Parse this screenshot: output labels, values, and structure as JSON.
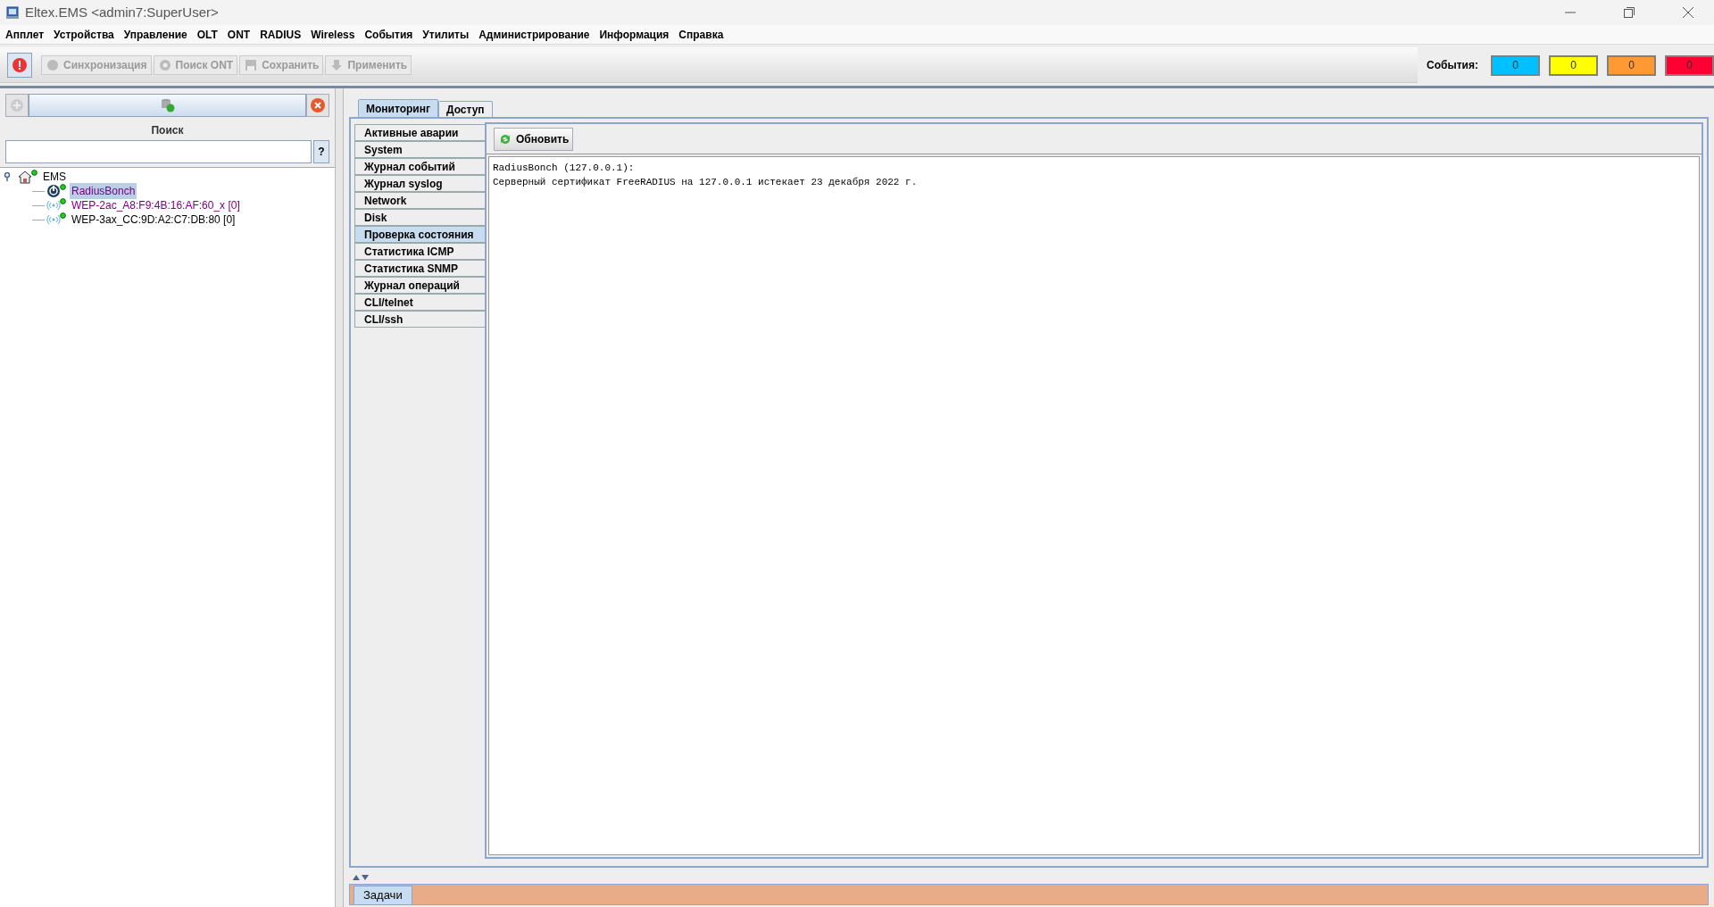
{
  "window": {
    "title": "Eltex.EMS <admin7:SuperUser>"
  },
  "menu": [
    "Апплет",
    "Устройства",
    "Управление",
    "OLT",
    "ONT",
    "RADIUS",
    "Wireless",
    "События",
    "Утилиты",
    "Администрирование",
    "Информация",
    "Справка"
  ],
  "toolbar": {
    "buttons": [
      {
        "label": "Синхронизация",
        "disabled": true
      },
      {
        "label": "Поиск ONT",
        "disabled": true
      },
      {
        "label": "Сохранить",
        "disabled": true
      },
      {
        "label": "Применить",
        "disabled": true
      }
    ]
  },
  "events": {
    "label": "События:",
    "counters": [
      {
        "value": "0",
        "color": "#00c0ff"
      },
      {
        "value": "0",
        "color": "#ffff00"
      },
      {
        "value": "0",
        "color": "#ff9933"
      },
      {
        "value": "0",
        "color": "#ff0033"
      }
    ]
  },
  "sidebar": {
    "search_label": "Поиск",
    "help": "?",
    "tree": [
      {
        "label": "EMS",
        "expanded": true,
        "selected": false,
        "color": "#000000",
        "children": [
          {
            "label": "RadiusBonch",
            "kind": "radius",
            "selected": true,
            "color": "#800080"
          },
          {
            "label": "WEP-2ac_A8:F9:4B:16:AF:60_x [0]",
            "kind": "ap",
            "selected": false,
            "color": "#800080"
          },
          {
            "label": "WEP-3ax_CC:9D:A2:C7:DB:80 [0]",
            "kind": "ap",
            "selected": false,
            "color": "#000000"
          }
        ]
      }
    ]
  },
  "tabs": [
    {
      "label": "Мониторинг",
      "selected": true
    },
    {
      "label": "Доступ",
      "selected": false
    }
  ],
  "side_tabs": [
    {
      "label": "Активные аварии",
      "selected": false
    },
    {
      "label": "System",
      "selected": false
    },
    {
      "label": "Журнал событий",
      "selected": false
    },
    {
      "label": "Журнал syslog",
      "selected": false
    },
    {
      "label": "Network",
      "selected": false
    },
    {
      "label": "Disk",
      "selected": false
    },
    {
      "label": "Проверка состояния",
      "selected": true
    },
    {
      "label": "Статистика ICMP",
      "selected": false
    },
    {
      "label": "Статистика SNMP",
      "selected": false
    },
    {
      "label": "Журнал операций",
      "selected": false
    },
    {
      "label": "CLI/telnet",
      "selected": false
    },
    {
      "label": "CLI/ssh",
      "selected": false
    }
  ],
  "refresh_button": "Обновить",
  "output": [
    "RadiusBonch (127.0.0.1):",
    "Серверный сертификат FreeRADIUS на 127.0.0.1 истекает 23 декабря 2022 г."
  ],
  "bottom_tabs": [
    {
      "label": "Задачи",
      "selected": true
    }
  ]
}
